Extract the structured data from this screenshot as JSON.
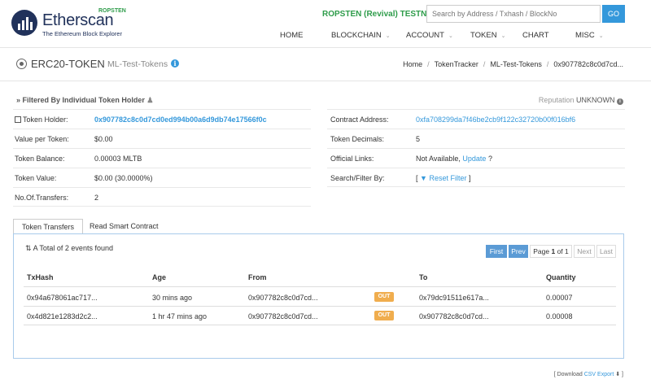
{
  "header": {
    "logo_name": "Etherscan",
    "logo_sub": "The Ethereum Block Explorer",
    "logo_network": "ROPSTEN",
    "testnet": "ROPSTEN (Revival) TESTNET",
    "search_placeholder": "Search by Address / Txhash / BlockNo",
    "go_label": "GO",
    "nav": [
      "HOME",
      "BLOCKCHAIN",
      "ACCOUNT",
      "TOKEN",
      "CHART",
      "MISC"
    ]
  },
  "title": {
    "main": "ERC20-TOKEN",
    "sub": "ML-Test-Tokens",
    "breadcrumb": [
      "Home",
      "TokenTracker",
      "ML-Test-Tokens",
      "0x907782c8c0d7cd..."
    ]
  },
  "filter": {
    "heading": "Filtered By Individual Token Holder",
    "reputation_label": "Reputation",
    "reputation_value": "UNKNOWN"
  },
  "left_rows": [
    {
      "label": "Token Holder:",
      "value": "0x907782c8c0d7cd0ed994b00a6d9db74e17566f0c"
    },
    {
      "label": "Value per Token:",
      "value": "$0.00"
    },
    {
      "label": "Token Balance:",
      "value": "0.00003 MLTB"
    },
    {
      "label": "Token Value:",
      "value": "$0.00 (30.0000%)"
    },
    {
      "label": "No.Of.Transfers:",
      "value": "2"
    }
  ],
  "right_rows": {
    "contract_label": "Contract Address:",
    "contract_value": "0xfa708299da7f46be2cb9f122c32720b00f016bf6",
    "decimals_label": "Token Decimals:",
    "decimals_value": "5",
    "links_label": "Official Links:",
    "links_value": "Not Available,",
    "links_update": "Update",
    "links_q": "?",
    "search_label": "Search/Filter By:",
    "search_open": "[",
    "search_value": "Reset Filter",
    "search_close": "]"
  },
  "tabs": [
    "Token Transfers",
    "Read Smart Contract"
  ],
  "transfers": {
    "summary": "A Total of 2 events found",
    "pager": {
      "first": "First",
      "prev": "Prev",
      "page": "Page",
      "current": "1",
      "of": "of",
      "total": "1",
      "next": "Next",
      "last": "Last"
    },
    "columns": [
      "TxHash",
      "Age",
      "From",
      "",
      "To",
      "Quantity"
    ],
    "rows": [
      {
        "txhash": "0x94a678061ac717...",
        "age": "30 mins ago",
        "from": "0x907782c8c0d7cd...",
        "dir": "OUT",
        "to": "0x79dc91511e617a...",
        "quantity": "0.00007"
      },
      {
        "txhash": "0x4d821e1283d2c2...",
        "age": "1 hr 47 mins ago",
        "from": "0x907782c8c0d7cd...",
        "dir": "OUT",
        "to": "0x907782c8c0d7cd...",
        "quantity": "0.00008"
      }
    ]
  },
  "footer": {
    "download": "Download",
    "csv": "CSV Export"
  },
  "colors": {
    "brand": "#21325b",
    "link": "#3498db",
    "testnet": "#2e9c4a",
    "out_badge": "#f0ad4e"
  }
}
